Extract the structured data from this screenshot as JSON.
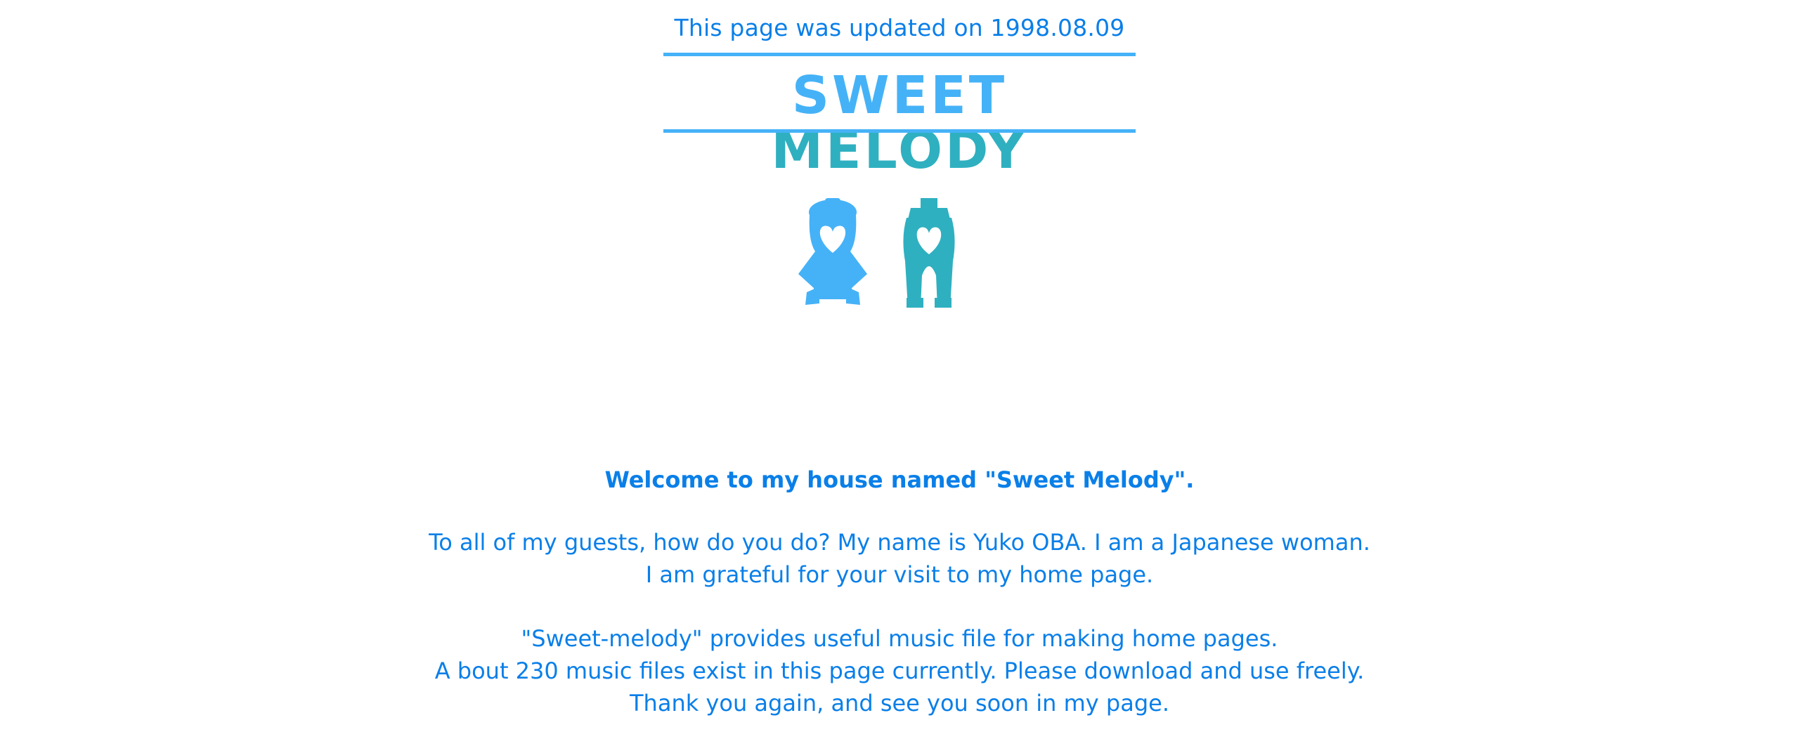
{
  "header": {
    "updated_text": "This page was updated on 1998.08.09"
  },
  "banner": {
    "title_part1": "SWEET",
    "title_part2": "MELODY",
    "colors": {
      "light_blue": "#45b2f7",
      "teal": "#2fb0c0",
      "text_blue": "#0a7fe8"
    }
  },
  "figures": {
    "left_icon": "girl-figure-with-heart-icon",
    "right_icon": "boy-figure-with-heart-icon"
  },
  "content": {
    "welcome": "Welcome to my house named \"Sweet Melody\".",
    "intro_lines": [
      "To all of my guests, how do you do? My name is Yuko OBA. I am a Japanese woman.",
      "I am grateful for your visit to my home page."
    ],
    "info_lines": [
      "\"Sweet-melody\" provides useful music file for making home pages.",
      "A bout 230 music files exist in this page currently. Please download and use freely.",
      "Thank you again, and see you soon in my page."
    ]
  }
}
